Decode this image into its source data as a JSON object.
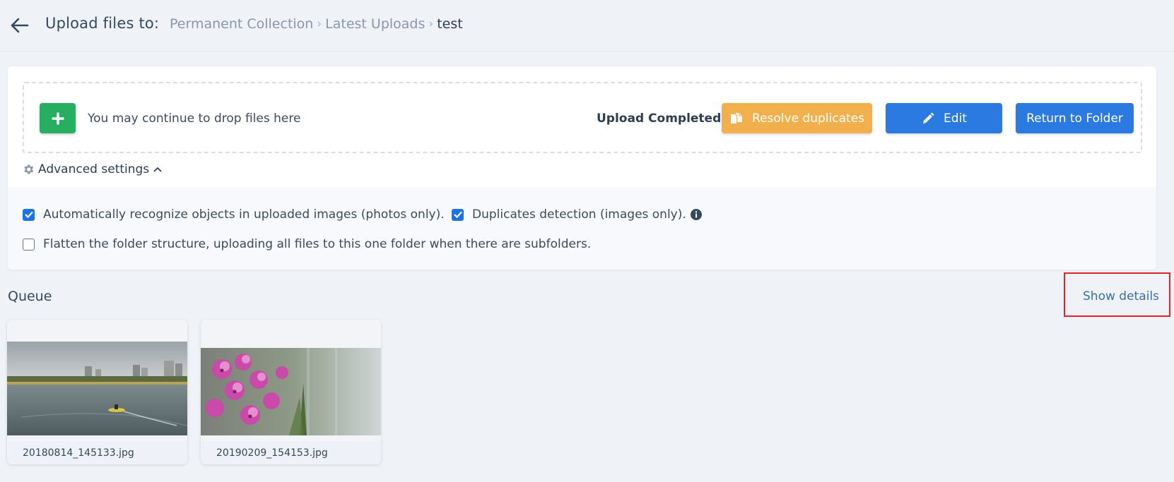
{
  "header": {
    "title": "Upload files to:",
    "breadcrumb": [
      "Permanent Collection",
      "Latest Uploads",
      "test"
    ]
  },
  "uploader": {
    "drop_text": "You may continue to drop files here",
    "status": "Upload Completed!",
    "resolve_label": "Resolve duplicates",
    "edit_label": "Edit",
    "return_label": "Return to Folder"
  },
  "advanced": {
    "label": "Advanced settings",
    "options": [
      {
        "label": "Automatically recognize objects in uploaded images (photos only).",
        "checked": true
      },
      {
        "label": "Duplicates detection (images only).",
        "checked": true
      },
      {
        "label": "Flatten the folder structure, uploading all files to this one folder when there are subfolders.",
        "checked": false
      }
    ]
  },
  "queue": {
    "title": "Queue",
    "show_details": "Show details",
    "files": [
      {
        "name": "20180814_145133.jpg"
      },
      {
        "name": "20190209_154153.jpg"
      }
    ]
  },
  "colors": {
    "add": "#27ae60",
    "resolve": "#f1b04c",
    "primary": "#2a7ae2",
    "highlight": "#e0222b"
  },
  "icons": {
    "back": "arrow-left-icon",
    "add": "plus-icon",
    "resolve": "copy-icon",
    "edit": "pencil-icon",
    "settings": "gear-icon",
    "toggle": "chevron-up-icon",
    "info": "info-circle-icon"
  }
}
